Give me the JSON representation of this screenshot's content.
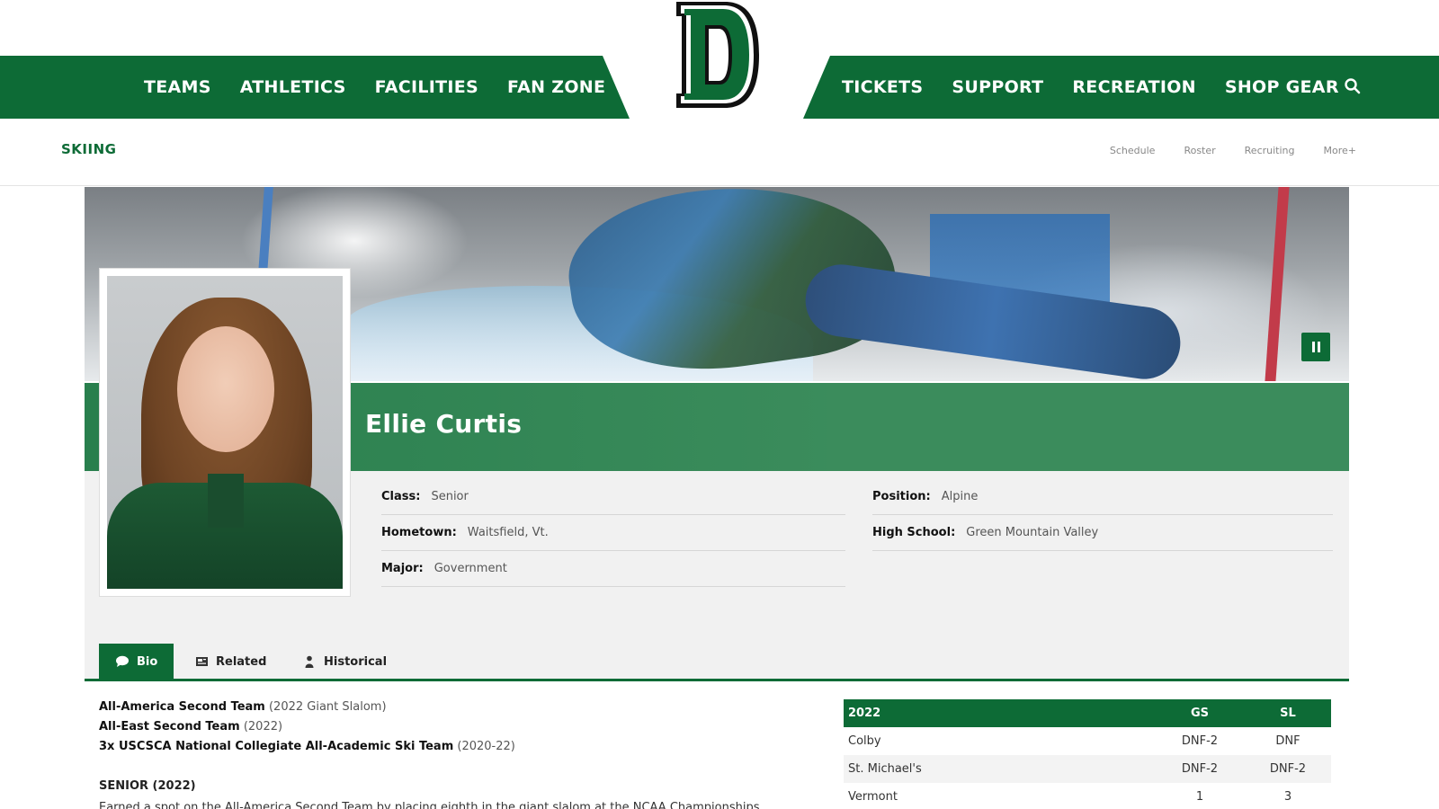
{
  "nav": {
    "left": [
      "TEAMS",
      "ATHLETICS",
      "FACILITIES",
      "FAN ZONE"
    ],
    "right": [
      "TICKETS",
      "SUPPORT",
      "RECREATION",
      "SHOP GEAR"
    ],
    "logo_letter": "D"
  },
  "sport": {
    "title": "SKIING",
    "links": [
      "Schedule",
      "Roster",
      "Recruiting",
      "More+"
    ]
  },
  "player": {
    "name": "Ellie Curtis",
    "fields": {
      "class_label": "Class:",
      "class_value": "Senior",
      "hometown_label": "Hometown:",
      "hometown_value": "Waitsfield, Vt.",
      "major_label": "Major:",
      "major_value": "Government",
      "position_label": "Position:",
      "position_value": "Alpine",
      "highschool_label": "High School:",
      "highschool_value": "Green Mountain Valley"
    }
  },
  "tabs": [
    {
      "label": "Bio",
      "icon": "speech-bubble-icon",
      "active": true
    },
    {
      "label": "Related",
      "icon": "newspaper-icon",
      "active": false
    },
    {
      "label": "Historical",
      "icon": "person-icon",
      "active": false
    }
  ],
  "bio": {
    "honors": [
      {
        "title": "All-America Second Team",
        "detail": "(2022 Giant Slalom)"
      },
      {
        "title": "All-East Second Team",
        "detail": "(2022)"
      },
      {
        "title": "3x USCSCA National Collegiate All-Academic Ski Team",
        "detail": "(2020-22)"
      }
    ],
    "season_heading": "SENIOR (2022)",
    "paragraph": "Earned a spot on the All-America Second Team by placing eighth in the giant slalom at the NCAA Championships"
  },
  "results": {
    "headers": [
      "2022",
      "GS",
      "SL"
    ],
    "rows": [
      [
        "Colby",
        "DNF-2",
        "DNF"
      ],
      [
        "St. Michael's",
        "DNF-2",
        "DNF-2"
      ],
      [
        "Vermont",
        "1",
        "3"
      ]
    ]
  },
  "colors": {
    "brand_green": "#0d6b36",
    "name_band": "#3b8c5c"
  }
}
